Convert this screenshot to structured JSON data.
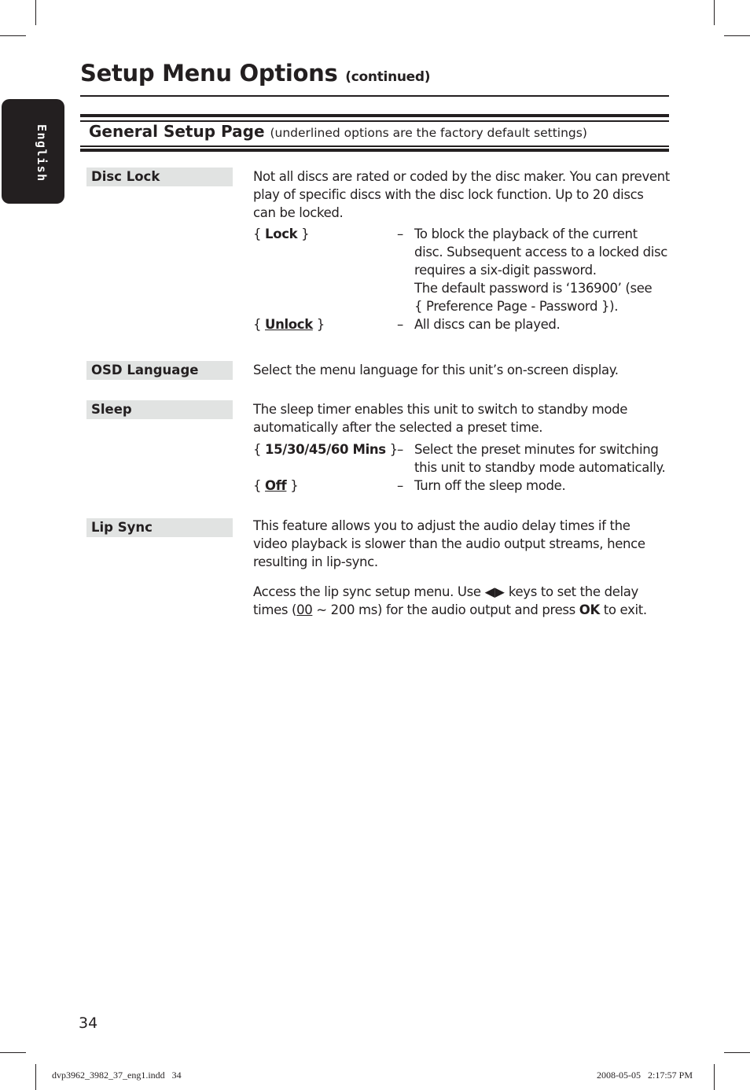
{
  "side_tab": {
    "label": "English"
  },
  "page_title": {
    "main": "Setup Menu Options",
    "suffix": "(continued)"
  },
  "section": {
    "title": "General Setup Page",
    "note": "(underlined options are the factory default settings)"
  },
  "items": [
    {
      "label": "Disc Lock",
      "description": "Not all discs are rated or coded by the disc maker. You can prevent play of specific discs with the disc lock function. Up to 20 discs can be locked.",
      "options": [
        {
          "open": "{ ",
          "name": "Lock",
          "close": " }",
          "default": false,
          "desc_lines": [
            "To block the playback of the current disc. Subsequent access to a locked disc requires a six-digit password.",
            "The default password is ‘136900’ (see { Preference Page - Password })."
          ]
        },
        {
          "open": "{ ",
          "name": "Unlock",
          "close": " }",
          "default": true,
          "desc_lines": [
            "All discs can be played."
          ]
        }
      ]
    },
    {
      "label": "OSD Language",
      "description": "Select the menu language for this unit’s on-screen display."
    },
    {
      "label": "Sleep",
      "description": "The sleep timer enables this unit to switch to standby mode automatically after the selected a preset time.",
      "options": [
        {
          "open": "{ ",
          "name": "15/30/45/60 Mins",
          "close": " }",
          "default": false,
          "desc_lines": [
            "Select the preset minutes for switching this unit to standby mode automatically."
          ]
        },
        {
          "open": "{ ",
          "name": "Off",
          "close": " }",
          "default": true,
          "desc_lines": [
            "Turn off the sleep mode."
          ]
        }
      ]
    },
    {
      "label": "Lip Sync",
      "description": "This feature allows you to adjust the audio delay times if the video playback is slower than the audio output streams, hence resulting in lip-sync.",
      "access": {
        "before_keys": "Access the lip sync setup menu. Use ",
        "keys_icon": "left-right-arrow-keys",
        "keys_glyph": "◀▶",
        "after_keys": " keys to set the delay times (",
        "default_value": "00",
        "range_rest": " ~ 200 ms) for the audio output and press ",
        "ok_key": "OK",
        "end": " to exit."
      }
    }
  ],
  "dash": "–",
  "page_number": "34",
  "footer": {
    "file": "dvp3962_3982_37_eng1.indd   34",
    "timestamp": "2008-05-05   2:17:57 PM"
  }
}
